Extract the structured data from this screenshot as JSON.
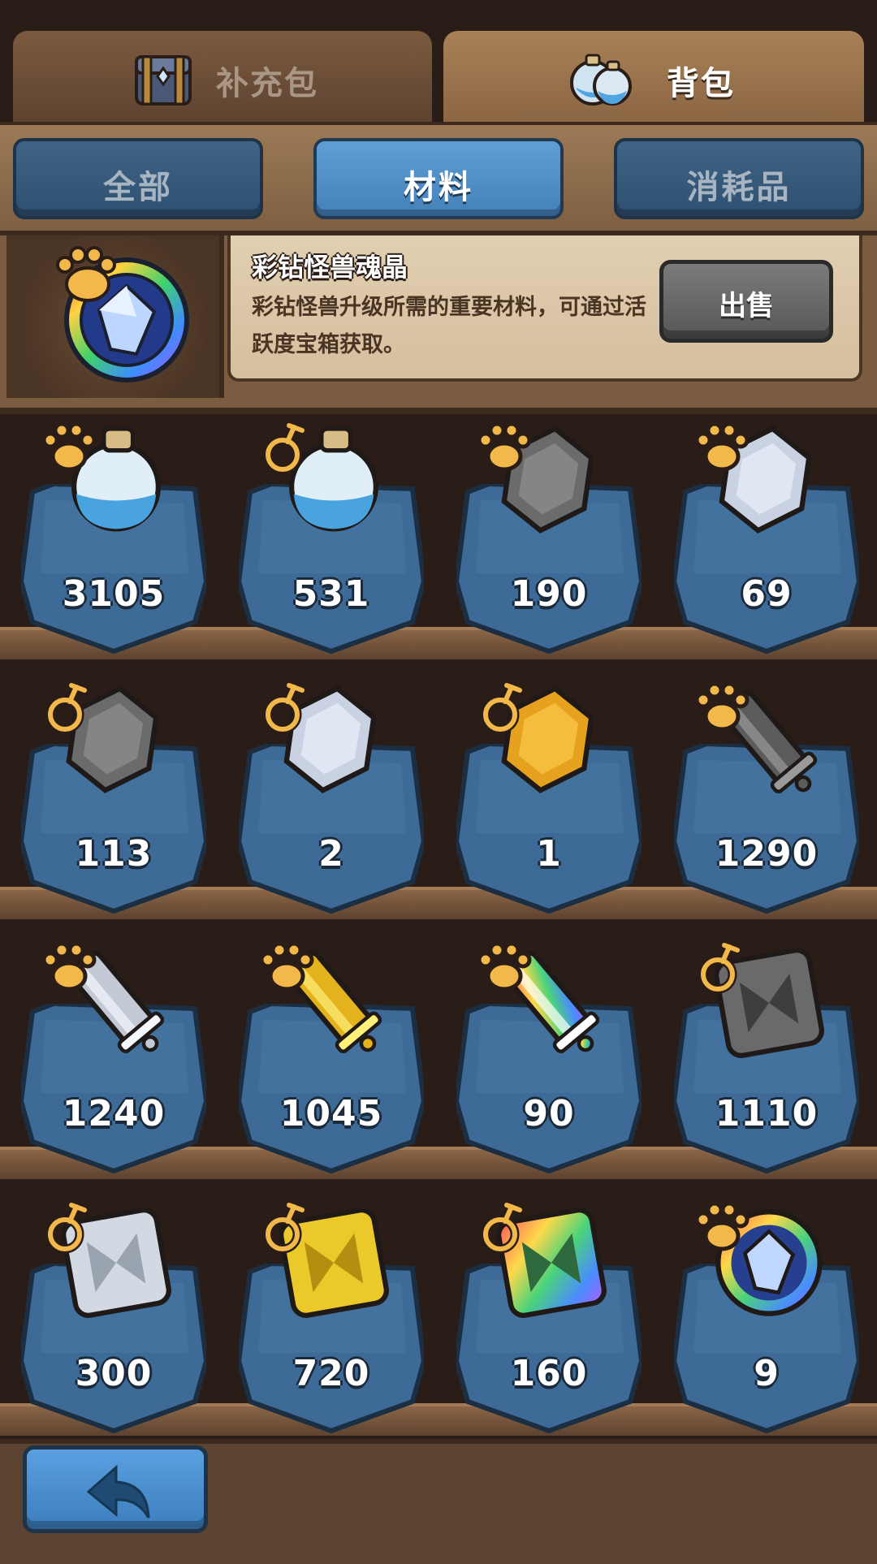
{
  "top_tabs": [
    {
      "label": "补充包",
      "icon": "chest-icon",
      "active": false
    },
    {
      "label": "背包",
      "icon": "potion-bag-icon",
      "active": true
    }
  ],
  "sub_tabs": [
    {
      "label": "全部",
      "active": false
    },
    {
      "label": "材料",
      "active": true
    },
    {
      "label": "消耗品",
      "active": false
    }
  ],
  "detail": {
    "icon": "rainbow-soul-crystal-icon",
    "name": "彩钻怪兽魂晶",
    "description": "彩钻怪兽升级所需的重要材料，可通过活跃度宝箱获取。",
    "sell_label": "出售"
  },
  "items": [
    {
      "icon": "blue-potion-icon",
      "badge": "paw-badge-icon",
      "count": "3105"
    },
    {
      "icon": "blue-potion-icon",
      "badge": "flask-badge-icon",
      "count": "531"
    },
    {
      "icon": "gray-gem-icon",
      "badge": "paw-badge-icon",
      "count": "190"
    },
    {
      "icon": "silver-gem-icon",
      "badge": "paw-badge-icon",
      "count": "69"
    },
    {
      "icon": "gray-gem-icon",
      "badge": "flask-badge-icon",
      "count": "113"
    },
    {
      "icon": "silver-gem-icon",
      "badge": "flask-badge-icon",
      "count": "2"
    },
    {
      "icon": "gold-gem-icon",
      "badge": "flask-badge-icon",
      "count": "1"
    },
    {
      "icon": "iron-scroll-icon",
      "badge": "paw-badge-icon",
      "count": "1290"
    },
    {
      "icon": "silver-scroll-icon",
      "badge": "paw-badge-icon",
      "count": "1240"
    },
    {
      "icon": "gold-scroll-icon",
      "badge": "paw-badge-icon",
      "count": "1045"
    },
    {
      "icon": "rainbow-scroll-icon",
      "badge": "paw-badge-icon",
      "count": "90"
    },
    {
      "icon": "iron-tile-icon",
      "badge": "flask-badge-icon",
      "count": "1110"
    },
    {
      "icon": "silver-tile-icon",
      "badge": "flask-badge-icon",
      "count": "300"
    },
    {
      "icon": "gold-tile-icon",
      "badge": "flask-badge-icon",
      "count": "720"
    },
    {
      "icon": "rainbow-tile-icon",
      "badge": "flask-badge-icon",
      "count": "160"
    },
    {
      "icon": "rainbow-soul-crystal-icon",
      "badge": "paw-badge-icon",
      "count": "9"
    }
  ],
  "back_icon": "back-arrow-icon",
  "colors": {
    "wood": "#7c5c40",
    "banner_blue": "#3d6a96",
    "tab_active_blue": "#4f8fcb",
    "paw_gold": "#f2b84a"
  }
}
